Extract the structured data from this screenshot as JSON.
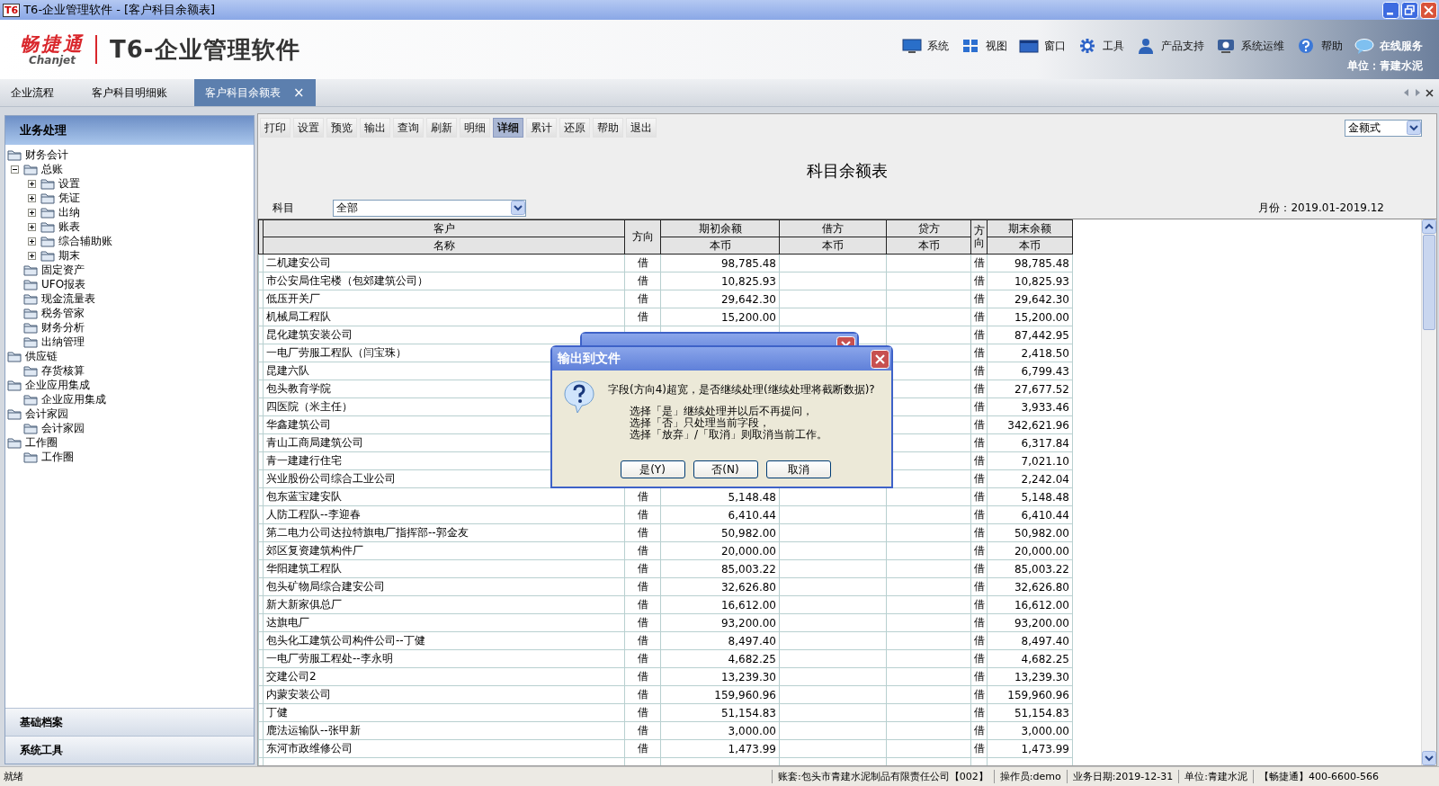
{
  "window": {
    "icon_label": "T6",
    "title": "T6-企业管理软件 - [客户科目余额表]"
  },
  "header": {
    "brand": "畅捷通",
    "brand_sub": "Chanjet",
    "product": "T6-企业管理软件",
    "menu": [
      {
        "label": "系统"
      },
      {
        "label": "视图"
      },
      {
        "label": "窗口"
      },
      {
        "label": "工具"
      },
      {
        "label": "产品支持"
      },
      {
        "label": "系统运维"
      },
      {
        "label": "帮助"
      },
      {
        "label": "在线服务"
      }
    ],
    "unit": "单位：青建水泥"
  },
  "tabs": [
    {
      "label": "企业流程",
      "selected": false
    },
    {
      "label": "客户科目明细账",
      "selected": false
    },
    {
      "label": "客户科目余额表",
      "selected": true,
      "close": "×"
    }
  ],
  "sidebar": {
    "title": "业务处理",
    "tree": [
      {
        "label": "财务会计",
        "children": [
          {
            "label": "总账",
            "expanded": true,
            "children": [
              {
                "label": "设置",
                "expanded": false
              },
              {
                "label": "凭证",
                "expanded": false
              },
              {
                "label": "出纳",
                "expanded": false
              },
              {
                "label": "账表",
                "expanded": false
              },
              {
                "label": "综合辅助账",
                "expanded": false
              },
              {
                "label": "期末",
                "expanded": false
              }
            ]
          },
          {
            "label": "固定资产"
          },
          {
            "label": "UFO报表"
          },
          {
            "label": "现金流量表"
          },
          {
            "label": "税务管家"
          },
          {
            "label": "财务分析"
          },
          {
            "label": "出纳管理"
          }
        ]
      },
      {
        "label": "供应链",
        "children": [
          {
            "label": "存货核算"
          }
        ]
      },
      {
        "label": "企业应用集成",
        "children": [
          {
            "label": "企业应用集成"
          }
        ]
      },
      {
        "label": "会计家园",
        "children": [
          {
            "label": "会计家园"
          }
        ]
      },
      {
        "label": "工作圈",
        "children": [
          {
            "label": "工作圈"
          }
        ]
      }
    ],
    "sections": [
      "基础档案",
      "系统工具"
    ]
  },
  "toolbar": [
    {
      "label": "打印",
      "selected": false
    },
    {
      "label": "设置",
      "selected": false
    },
    {
      "label": "预览",
      "selected": false
    },
    {
      "label": "输出",
      "selected": false
    },
    {
      "label": "查询",
      "selected": false
    },
    {
      "label": "刷新",
      "selected": false
    },
    {
      "label": "明细",
      "selected": false
    },
    {
      "label": "详细",
      "selected": true
    },
    {
      "label": "累计",
      "selected": false
    },
    {
      "label": "还原",
      "selected": false
    },
    {
      "label": "帮助",
      "selected": false
    },
    {
      "label": "退出",
      "selected": false
    }
  ],
  "view_select": "金额式",
  "report": {
    "title": "科目余额表",
    "filter_label": "科目",
    "filter_value": "全部",
    "period": "月份：2019.01-2019.12",
    "columns": [
      {
        "label": "客户",
        "sub": "名称"
      },
      {
        "label": "方向"
      },
      {
        "label": "期初余额",
        "sub": "本币"
      },
      {
        "label": "借方",
        "sub": "本币"
      },
      {
        "label": "贷方",
        "sub": "本币"
      },
      {
        "label": "方向"
      },
      {
        "label": "期末余额",
        "sub": "本币"
      }
    ],
    "rows": [
      {
        "name": "二机建安公司",
        "direction": "借",
        "opening": "98,785.48",
        "end_direction": "借",
        "closing": "98,785.48"
      },
      {
        "name": "市公安局住宅楼（包郊建筑公司）",
        "direction": "借",
        "opening": "10,825.93",
        "end_direction": "借",
        "closing": "10,825.93"
      },
      {
        "name": "低压开关厂",
        "direction": "借",
        "opening": "29,642.30",
        "end_direction": "借",
        "closing": "29,642.30"
      },
      {
        "name": "机械局工程队",
        "direction": "借",
        "opening": "15,200.00",
        "end_direction": "借",
        "closing": "15,200.00"
      },
      {
        "name": "昆化建筑安装公司",
        "end_direction": "借",
        "closing": "87,442.95"
      },
      {
        "name": "一电厂劳服工程队（闫宝珠）",
        "end_direction": "借",
        "closing": "2,418.50"
      },
      {
        "name": "昆建六队",
        "end_direction": "借",
        "closing": "6,799.43"
      },
      {
        "name": "包头教育学院",
        "end_direction": "借",
        "closing": "27,677.52"
      },
      {
        "name": "四医院（米主任）",
        "end_direction": "借",
        "closing": "3,933.46"
      },
      {
        "name": "华鑫建筑公司",
        "end_direction": "借",
        "closing": "342,621.96"
      },
      {
        "name": "青山工商局建筑公司",
        "end_direction": "借",
        "closing": "6,317.84"
      },
      {
        "name": "青一建建行住宅",
        "end_direction": "借",
        "closing": "7,021.10"
      },
      {
        "name": "兴业股份公司综合工业公司",
        "end_direction": "借",
        "closing": "2,242.04"
      },
      {
        "name": "包东蓝宝建安队",
        "direction": "借",
        "opening": "5,148.48",
        "end_direction": "借",
        "closing": "5,148.48"
      },
      {
        "name": "人防工程队--李迎春",
        "direction": "借",
        "opening": "6,410.44",
        "end_direction": "借",
        "closing": "6,410.44"
      },
      {
        "name": "第二电力公司达拉特旗电厂指挥部--郭金友",
        "direction": "借",
        "opening": "50,982.00",
        "end_direction": "借",
        "closing": "50,982.00"
      },
      {
        "name": "郊区复资建筑构件厂",
        "direction": "借",
        "opening": "20,000.00",
        "end_direction": "借",
        "closing": "20,000.00"
      },
      {
        "name": "华阳建筑工程队",
        "direction": "借",
        "opening": "85,003.22",
        "end_direction": "借",
        "closing": "85,003.22"
      },
      {
        "name": "包头矿物局综合建安公司",
        "direction": "借",
        "opening": "32,626.80",
        "end_direction": "借",
        "closing": "32,626.80"
      },
      {
        "name": "新大新家俱总厂",
        "direction": "借",
        "opening": "16,612.00",
        "end_direction": "借",
        "closing": "16,612.00"
      },
      {
        "name": "达旗电厂",
        "direction": "借",
        "opening": "93,200.00",
        "end_direction": "借",
        "closing": "93,200.00"
      },
      {
        "name": "包头化工建筑公司构件公司--丁健",
        "direction": "借",
        "opening": "8,497.40",
        "end_direction": "借",
        "closing": "8,497.40"
      },
      {
        "name": "一电厂劳服工程处--李永明",
        "direction": "借",
        "opening": "4,682.25",
        "end_direction": "借",
        "closing": "4,682.25"
      },
      {
        "name": "交建公司2",
        "direction": "借",
        "opening": "13,239.30",
        "end_direction": "借",
        "closing": "13,239.30"
      },
      {
        "name": "内蒙安装公司",
        "direction": "借",
        "opening": "159,960.96",
        "end_direction": "借",
        "closing": "159,960.96"
      },
      {
        "name": "丁健",
        "direction": "借",
        "opening": "51,154.83",
        "end_direction": "借",
        "closing": "51,154.83"
      },
      {
        "name": "鹿法运输队--张甲新",
        "direction": "借",
        "opening": "3,000.00",
        "end_direction": "借",
        "closing": "3,000.00"
      },
      {
        "name": "东河市政维修公司",
        "direction": "借",
        "opening": "1,473.99",
        "end_direction": "借",
        "closing": "1,473.99"
      }
    ]
  },
  "dialog": {
    "title": "输出到文件",
    "question": "字段(方向4)超宽，是否继续处理(继续处理将截断数据)?",
    "details": [
      "选择「是」继续处理并以后不再提问，",
      "选择「否」只处理当前字段，",
      "选择「放弃」/「取消」则取消当前工作。"
    ],
    "buttons": [
      "是(Y)",
      "否(N)",
      "取消"
    ]
  },
  "status_bar": [
    "就绪",
    "账套:包头市青建水泥制品有限责任公司【002】",
    "操作员:demo",
    "业务日期:2019-12-31",
    "单位:青建水泥",
    "【畅捷通】400-6600-566"
  ]
}
